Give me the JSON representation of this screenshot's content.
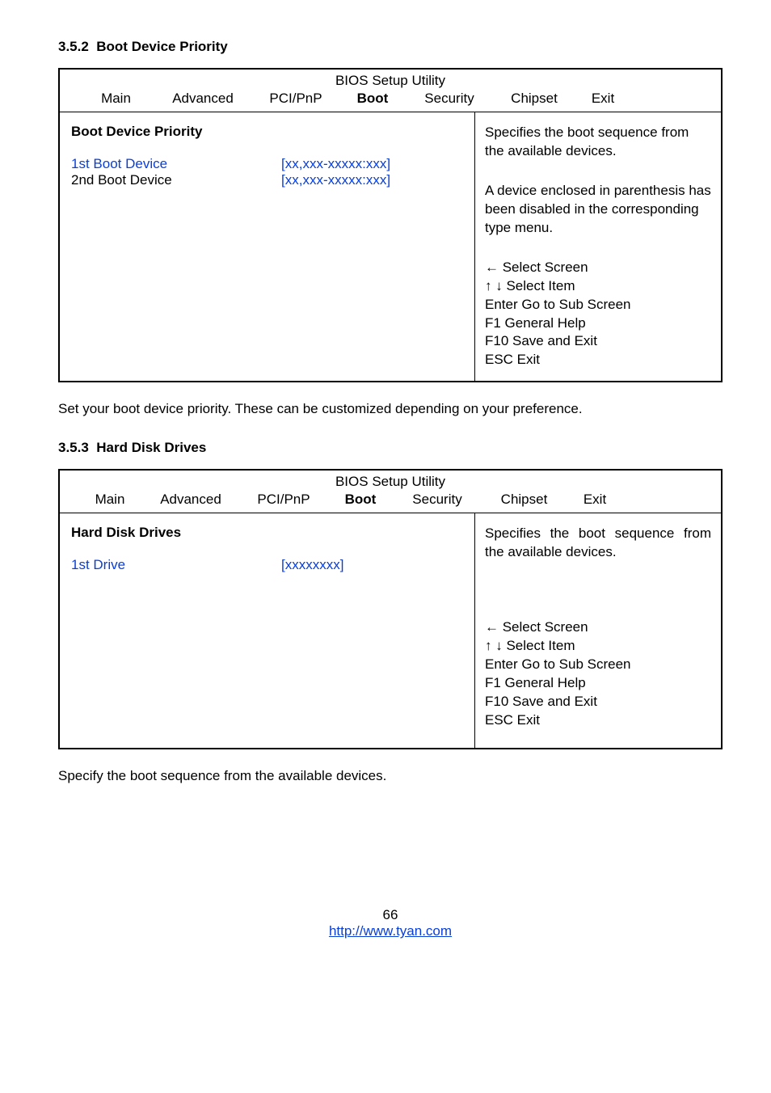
{
  "section1": {
    "number": "3.5.2",
    "title": "Boot Device Priority"
  },
  "bios1": {
    "title": "BIOS Setup Utility",
    "tabs": {
      "main": "Main",
      "advanced": "Advanced",
      "pcipnp": "PCI/PnP",
      "boot": "Boot",
      "security": "Security",
      "chipset": "Chipset",
      "exit": "Exit"
    },
    "left": {
      "heading": "Boot Device Priority",
      "row1_label": "1st Boot Device",
      "row1_value": "[xx,xxx-xxxxx:xxx]",
      "row2_label": "2nd Boot Device",
      "row2_value": "[xx,xxx-xxxxx:xxx]"
    },
    "right": {
      "desc1": "Specifies the boot sequence from the available devices.",
      "desc2": "A device enclosed in parenthesis has been disabled in the corresponding type menu.",
      "keys": {
        "select_screen": "←      Select Screen",
        "select_item": "↑ ↓  Select Item",
        "enter": "Enter Go to Sub Screen",
        "f1": "F1      General Help",
        "f10": "F10   Save and Exit",
        "esc": "ESC  Exit"
      }
    }
  },
  "para1": "Set your boot device priority.  These can be customized depending on your preference.",
  "section2": {
    "number": "3.5.3",
    "title": "Hard Disk Drives"
  },
  "bios2": {
    "title": "BIOS Setup Utility",
    "tabs": {
      "main": "Main",
      "advanced": "Advanced",
      "pcipnp": "PCI/PnP",
      "boot": "Boot",
      "security": "Security",
      "chipset": "Chipset",
      "exit": "Exit"
    },
    "left": {
      "heading": "Hard Disk Drives",
      "row1_label": "1st Drive",
      "row1_value": "[xxxxxxxx]"
    },
    "right": {
      "desc1": "Specifies the boot sequence from the available devices.",
      "keys": {
        "select_screen": "←      Select Screen",
        "select_item": "↑ ↓  Select Item",
        "enter": "Enter Go to Sub Screen",
        "f1": "F1      General Help",
        "f10": "F10   Save and Exit",
        "esc": "ESC  Exit"
      }
    }
  },
  "para2": "Specify the boot sequence from the available devices.",
  "footer": {
    "page": "66",
    "url": "http://www.tyan.com"
  }
}
